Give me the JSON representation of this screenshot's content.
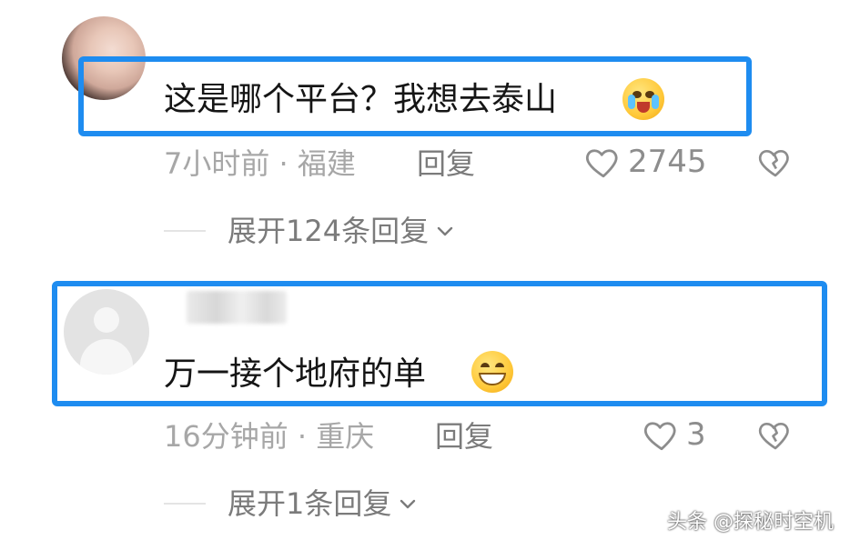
{
  "comments": [
    {
      "text": "这是哪个平台？我想去泰山",
      "time_location": "7小时前 · 福建",
      "reply_label": "回复",
      "likes": "2745",
      "expand_label": "展开124条回复"
    },
    {
      "text": "万一接个地府的单",
      "time_location": "16分钟前 · 重庆",
      "reply_label": "回复",
      "likes": "3",
      "expand_label": "展开1条回复"
    }
  ],
  "watermark": "头条 @探秘时空机",
  "colors": {
    "highlight_border": "#1e8cf0",
    "meta_text": "#a7a7a7",
    "body_text": "#151515"
  },
  "icons": {
    "like": "heart-icon",
    "dislike": "broken-heart-icon",
    "expand": "chevron-down-icon"
  }
}
